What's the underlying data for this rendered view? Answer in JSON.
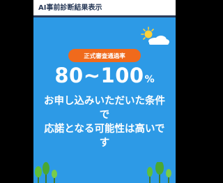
{
  "header": {
    "title": "AI事前診断結果表示"
  },
  "result": {
    "badge": "正式審査通過率",
    "rate_value": "80~100",
    "rate_unit": "%",
    "message_lines": [
      "お申し込みいただいた条件",
      "で",
      "応諾となる可能性は高いで",
      "す"
    ]
  },
  "colors": {
    "panel_bg": "#2d9ae6",
    "badge_bg": "#f06a1c",
    "header_text": "#2b3c5a",
    "outer_bg": "#000000"
  },
  "icons": [
    "sun-icon",
    "cloud-icon",
    "tree-icon"
  ]
}
